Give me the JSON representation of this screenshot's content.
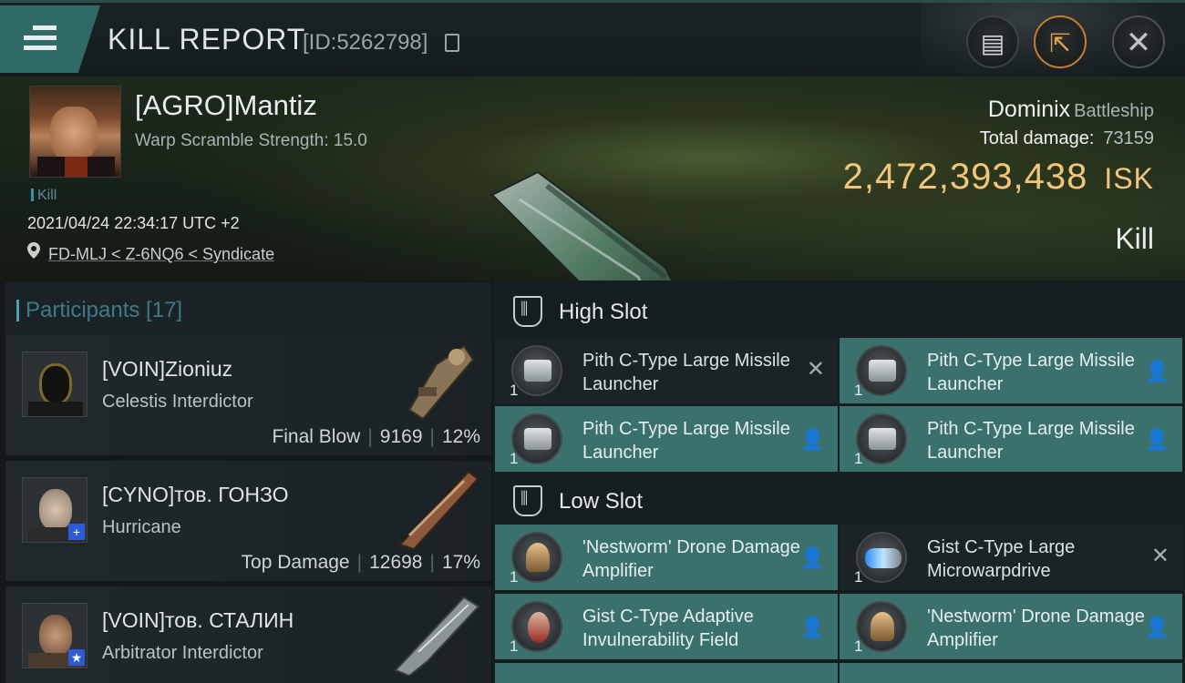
{
  "header": {
    "title": "KILL REPORT",
    "id_text": "[ID:5262798]",
    "icons": {
      "menu": "hamburger-menu-icon",
      "notes": "clipboard-icon",
      "share": "share-icon",
      "close": "close-icon"
    }
  },
  "victim": {
    "name": "[AGRO]Mantiz",
    "warp_scramble": "Warp Scramble Strength: 15.0",
    "tag": "Kill",
    "datetime": "2021/04/24 22:34:17 UTC +2",
    "location": "FD-MLJ < Z-6NQ6 < Syndicate",
    "ship_name": "Dominix",
    "ship_class": "Battleship",
    "total_damage_label": "Total damage:",
    "total_damage": "73159",
    "isk_value": "2,472,393,438",
    "isk_unit": "ISK",
    "result": "Kill"
  },
  "participants": {
    "title": "Participants [17]",
    "list": [
      {
        "name": "[VOIN]Zioniuz",
        "ship": "Celestis Interdictor",
        "role": "Final Blow",
        "damage": "9169",
        "percent": "12%"
      },
      {
        "name": "[CYNO]тов. ГОНЗО",
        "ship": "Hurricane",
        "role": "Top Damage",
        "damage": "12698",
        "percent": "17%"
      },
      {
        "name": "[VOIN]тов. СТАЛИН",
        "ship": "Arbitrator Interdictor",
        "role": "",
        "damage": "",
        "percent": ""
      }
    ]
  },
  "slots": {
    "high": {
      "title": "High Slot",
      "items": [
        {
          "name": "Pith C-Type Large Missile Launcher",
          "qty": "1",
          "status": "destroyed"
        },
        {
          "name": "Pith C-Type Large Missile Launcher",
          "qty": "1",
          "status": "dropped"
        },
        {
          "name": "Pith C-Type Large Missile Launcher",
          "qty": "1",
          "status": "dropped"
        },
        {
          "name": "Pith C-Type Large Missile Launcher",
          "qty": "1",
          "status": "dropped"
        }
      ]
    },
    "low": {
      "title": "Low Slot",
      "items": [
        {
          "name": "'Nestworm' Drone Damage Amplifier",
          "qty": "1",
          "status": "dropped"
        },
        {
          "name": "Gist C-Type Large Microwarpdrive",
          "qty": "1",
          "status": "destroyed"
        },
        {
          "name": "Gist C-Type Adaptive Invulnerability Field",
          "qty": "1",
          "status": "dropped"
        },
        {
          "name": "'Nestworm' Drone Damage Amplifier",
          "qty": "1",
          "status": "dropped"
        }
      ]
    }
  },
  "colors": {
    "accent": "#3b716c",
    "isk": "#f1c57a",
    "panel": "#1c2326"
  }
}
